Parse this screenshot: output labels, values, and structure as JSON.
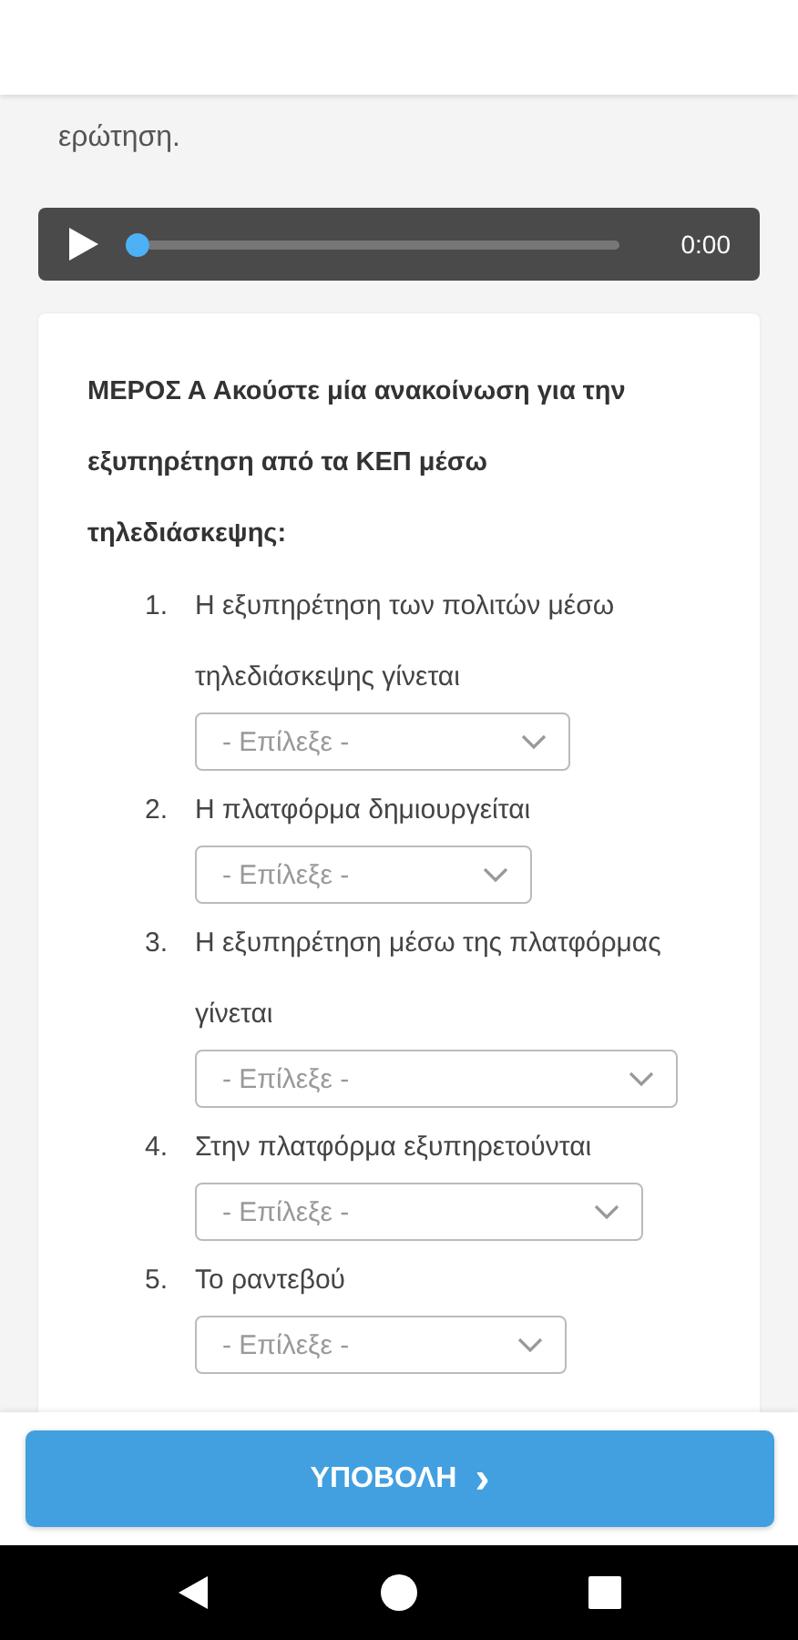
{
  "intro": {
    "text": "ερώτηση."
  },
  "player": {
    "time": "0:00",
    "level": 0
  },
  "section": {
    "title": "ΜΕΡΟΣ Α Ακούστε μία ανακοίνωση για την εξυπηρέτηση από τα ΚΕΠ μέσω τηλεδιάσκεψης:",
    "questions": [
      {
        "number": "1.",
        "text": "Η εξυπηρέτηση των πολιτών μέσω τηλεδιάσκεψης γίνεται",
        "placeholder": "- Επίλεξε -"
      },
      {
        "number": "2.",
        "text": "Η πλατφόρμα δημιουργείται",
        "placeholder": "- Επίλεξε -"
      },
      {
        "number": "3.",
        "text": "Η εξυπηρέτηση μέσω της πλατφόρμας γίνεται",
        "placeholder": "- Επίλεξε -"
      },
      {
        "number": "4.",
        "text": "Στην πλατφόρμα εξυπηρετούνται",
        "placeholder": "- Επίλεξε -"
      },
      {
        "number": "5.",
        "text": "Το ραντεβού",
        "placeholder": "- Επίλεξε -"
      }
    ]
  },
  "submit": {
    "label": "ΥΠΟΒΟΛΗ",
    "icon": "›"
  }
}
